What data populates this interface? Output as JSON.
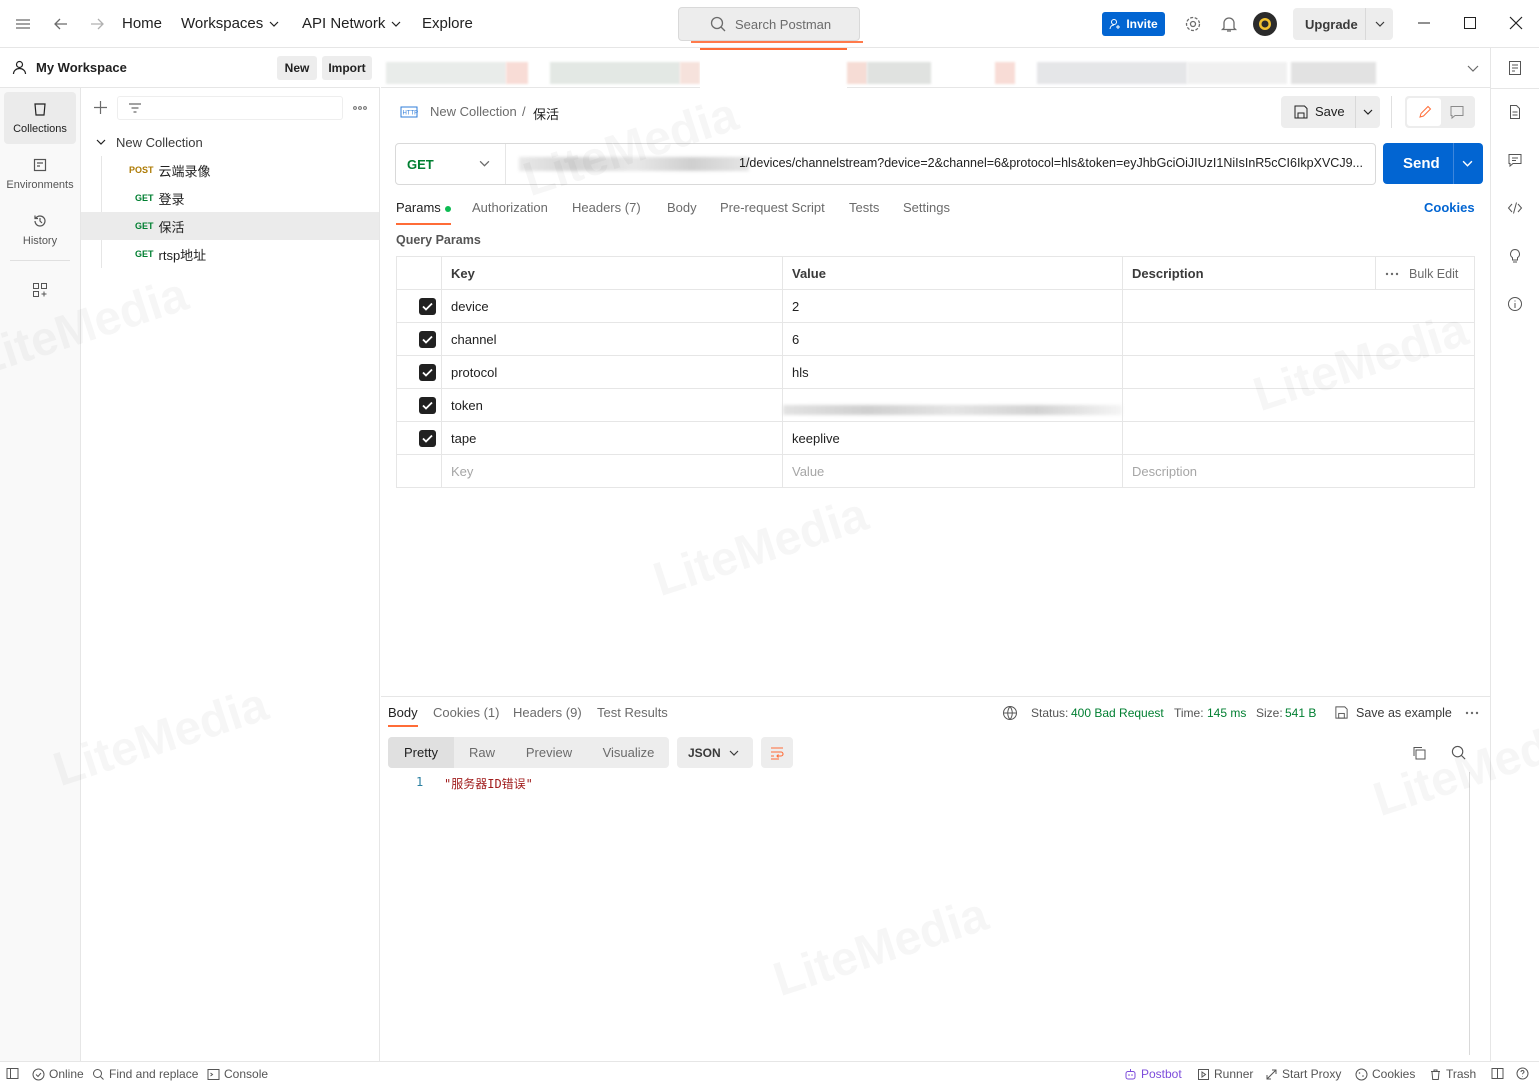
{
  "titlebar": {
    "nav": [
      "Home",
      "Workspaces",
      "API Network",
      "Explore"
    ],
    "search_placeholder": "Search Postman",
    "invite_label": "Invite",
    "upgrade_label": "Upgrade"
  },
  "workspace": {
    "name": "My Workspace",
    "new_label": "New",
    "import_label": "Import"
  },
  "rail": {
    "items": [
      "Collections",
      "Environments",
      "History"
    ]
  },
  "collection": {
    "name": "New Collection",
    "requests": [
      {
        "method": "POST",
        "name": "云端录像"
      },
      {
        "method": "GET",
        "name": "登录"
      },
      {
        "method": "GET",
        "name": "保活"
      },
      {
        "method": "GET",
        "name": "rtsp地址"
      }
    ]
  },
  "request": {
    "breadcrumb_collection": "New Collection",
    "breadcrumb_separator": "/",
    "breadcrumb_name": "保活",
    "save_label": "Save",
    "method": "GET",
    "url_visible": "1/devices/channelstream?device=2&channel=6&protocol=hls&token=eyJhbGciOiJIUzI1NiIsInR5cCI6IkpXVCJ9...",
    "send_label": "Send",
    "tabs": [
      "Params",
      "Authorization",
      "Headers",
      "Body",
      "Pre-request Script",
      "Tests",
      "Settings"
    ],
    "headers_count": "(7)",
    "cookies_label": "Cookies",
    "query_params_title": "Query Params",
    "table": {
      "headers": [
        "Key",
        "Value",
        "Description"
      ],
      "bulk_edit": "Bulk Edit",
      "rows": [
        {
          "key": "device",
          "value": "2"
        },
        {
          "key": "channel",
          "value": "6"
        },
        {
          "key": "protocol",
          "value": "hls"
        },
        {
          "key": "token",
          "value": ""
        },
        {
          "key": "tape",
          "value": "keeplive"
        }
      ],
      "placeholders": {
        "key": "Key",
        "value": "Value",
        "description": "Description"
      }
    }
  },
  "response": {
    "tabs": [
      "Body",
      "Cookies",
      "Headers",
      "Test Results"
    ],
    "cookies_count": "(1)",
    "headers_count": "(9)",
    "status_label": "Status:",
    "status_value": "400 Bad Request",
    "time_label": "Time:",
    "time_value": "145 ms",
    "size_label": "Size:",
    "size_value": "541 B",
    "save_example": "Save as example",
    "formats": [
      "Pretty",
      "Raw",
      "Preview",
      "Visualize"
    ],
    "language": "JSON",
    "line_number": "1",
    "body_line": "\"服务器ID错误\""
  },
  "statusbar": {
    "left": [
      "Online",
      "Find and replace",
      "Console"
    ],
    "right": [
      "Postbot",
      "Runner",
      "Start Proxy",
      "Cookies",
      "Trash"
    ]
  },
  "watermark": "LiteMedia",
  "colors": {
    "accent": "#ff6c37",
    "primary": "#0265d2",
    "get": "#007f31",
    "post": "#ad7a03",
    "status": "#007f31"
  }
}
